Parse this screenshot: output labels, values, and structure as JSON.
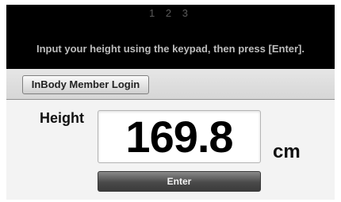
{
  "header": {
    "steps": "1 2 3",
    "instruction": "Input your height using the keypad, then press [Enter]."
  },
  "login": {
    "button_label": "InBody Member Login"
  },
  "height": {
    "label": "Height",
    "value": "169.8",
    "unit": "cm"
  },
  "actions": {
    "enter_label": "Enter"
  },
  "colors": {
    "header_bg": "#000000",
    "instruction_text": "#bdbdbd",
    "panel_bg": "#f3f3f3",
    "enter_button_bg": "#4a4a4a"
  }
}
